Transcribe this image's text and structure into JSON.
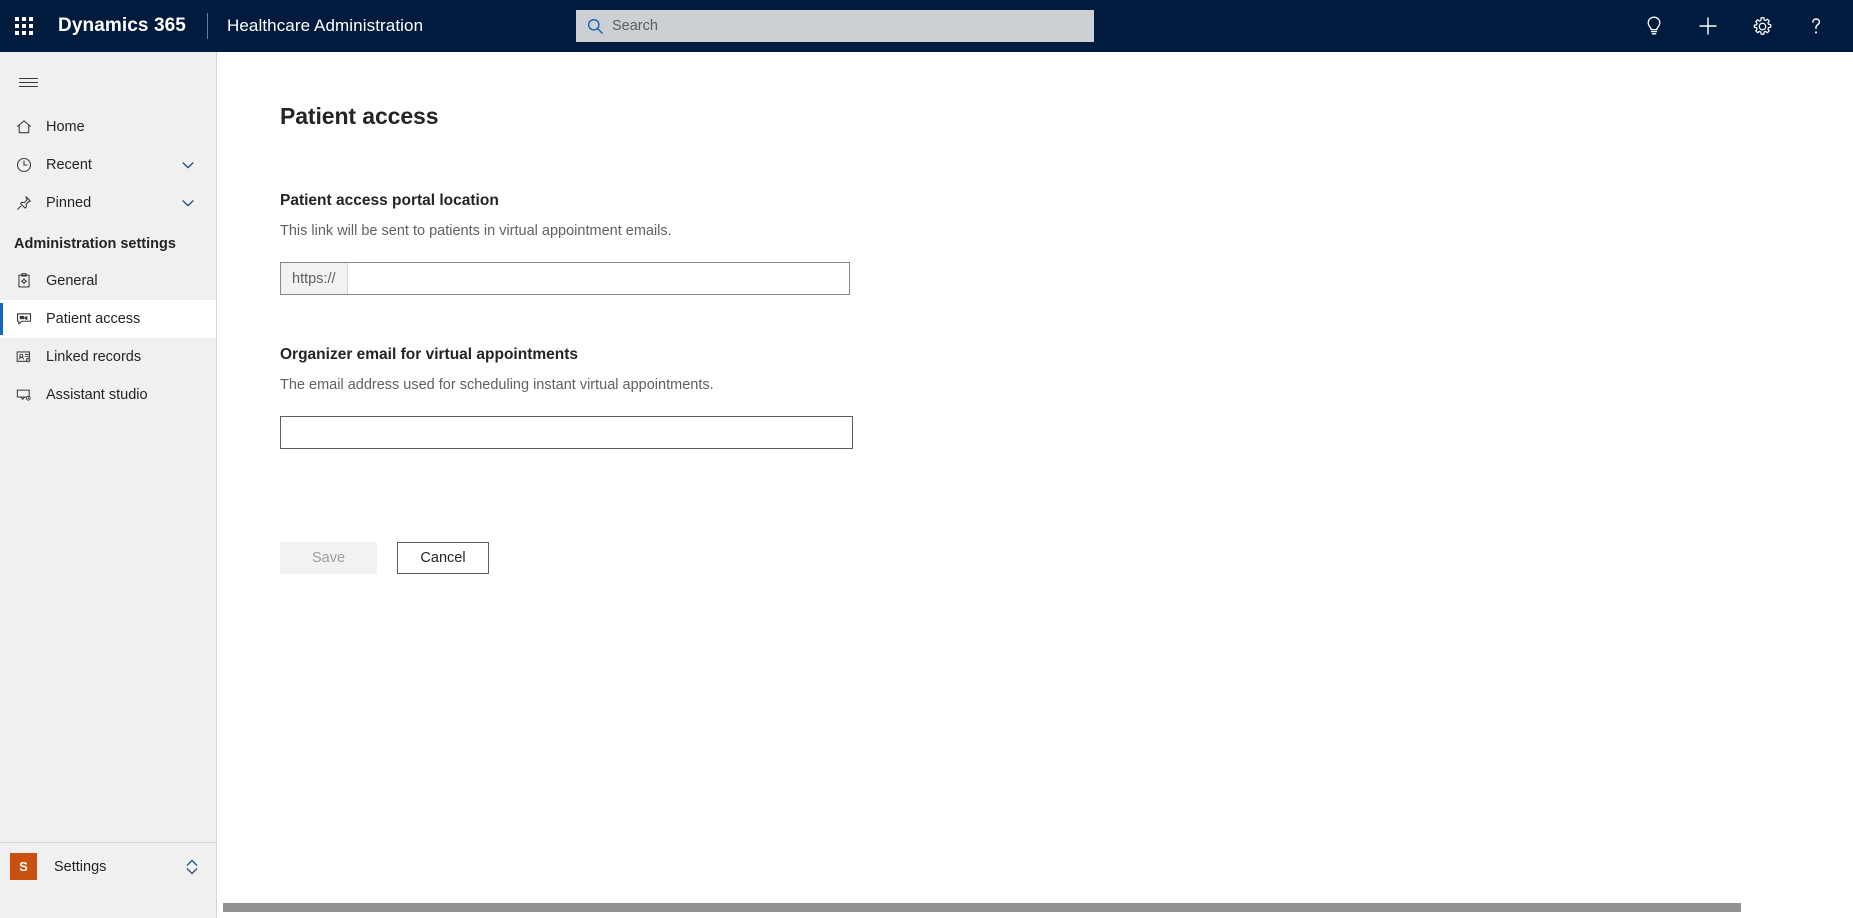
{
  "header": {
    "waffle_label": "app-launcher",
    "brand": "Dynamics 365",
    "app_name": "Healthcare Administration",
    "search": {
      "placeholder": "Search",
      "value": ""
    },
    "icons": [
      {
        "name": "lightbulb-icon",
        "label": "Insights"
      },
      {
        "name": "plus-icon",
        "label": "New"
      },
      {
        "name": "gear-icon",
        "label": "Settings"
      },
      {
        "name": "question-icon",
        "label": "Help"
      }
    ],
    "background_color": "#001b3d"
  },
  "sidebar": {
    "hamburger_label": "Expand or collapse navigation",
    "items": [
      {
        "label": "Home",
        "icon": "home-icon",
        "selected": false,
        "chevron": false
      },
      {
        "label": "Recent",
        "icon": "clock-icon",
        "selected": false,
        "chevron": true
      },
      {
        "label": "Pinned",
        "icon": "pin-icon",
        "selected": false,
        "chevron": true
      }
    ],
    "group_title": "Administration settings",
    "group_items": [
      {
        "label": "General",
        "icon": "clipboard-gear-icon",
        "selected": false
      },
      {
        "label": "Patient access",
        "icon": "video-chat-icon",
        "selected": true
      },
      {
        "label": "Linked records",
        "icon": "contact-card-gear-icon",
        "selected": false
      },
      {
        "label": "Assistant studio",
        "icon": "monitor-gear-icon",
        "selected": false
      }
    ],
    "settings": {
      "badge": "S",
      "label": "Settings",
      "chevron_icon": "chevron-up-down-icon"
    },
    "accent_color": "#0f6cbd",
    "background_color": "#f0f0f0",
    "badge_color": "#ca5010"
  },
  "main": {
    "page_title": "Patient access",
    "sections": [
      {
        "title": "Patient access portal location",
        "description": "This link will be sent to patients in virtual appointment emails.",
        "input": {
          "prefix": "https://",
          "value": "",
          "placeholder": ""
        }
      },
      {
        "title": "Organizer email for virtual appointments",
        "description": "The email address used for scheduling instant virtual appointments.",
        "input": {
          "value": "",
          "placeholder": ""
        }
      }
    ],
    "buttons": {
      "save": "Save",
      "save_disabled": true,
      "cancel": "Cancel"
    }
  },
  "scrollbar": {
    "orientation": "horizontal",
    "thumb_color": "#919191"
  }
}
